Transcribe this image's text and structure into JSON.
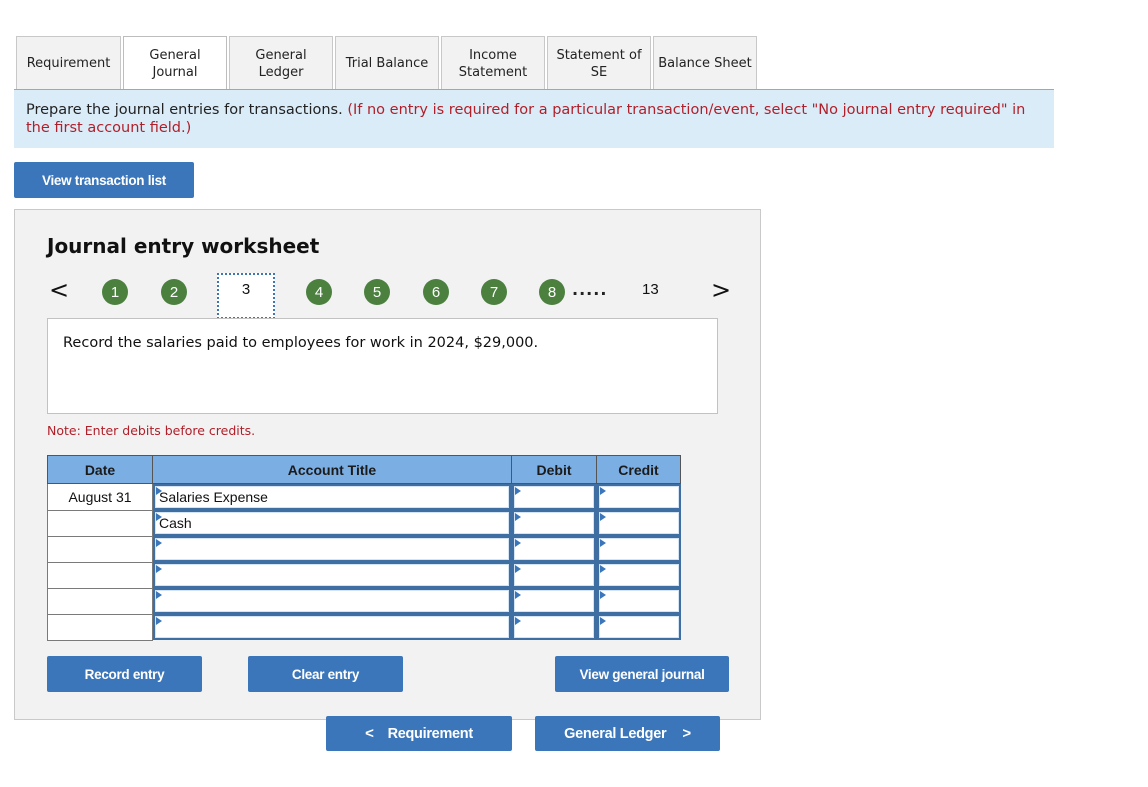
{
  "tabs": [
    {
      "label": "Requirement",
      "active": false
    },
    {
      "label": "General\nJournal",
      "active": true
    },
    {
      "label": "General\nLedger",
      "active": false
    },
    {
      "label": "Trial Balance",
      "active": false
    },
    {
      "label": "Income\nStatement",
      "active": false
    },
    {
      "label": "Statement of\nSE",
      "active": false
    },
    {
      "label": "Balance Sheet",
      "active": false
    }
  ],
  "instruction": {
    "main": "Prepare the journal entries for transactions.",
    "note": "(If no entry is required for a particular transaction/event, select \"No journal entry required\" in the first account field.)"
  },
  "view_transaction_list_label": "View transaction list",
  "worksheet": {
    "title": "Journal entry worksheet",
    "pager": {
      "prev_icon": "<",
      "next_icon": ">",
      "pages": [
        "1",
        "2",
        "3",
        "4",
        "5",
        "6",
        "7",
        "8"
      ],
      "current": "3",
      "ellipsis": ".....",
      "last": "13",
      "completed_color": "#4b803f"
    },
    "description": "Record the salaries paid to employees for work in 2024, $29,000.",
    "note": "Note: Enter debits before credits.",
    "table": {
      "headers": {
        "date": "Date",
        "account": "Account Title",
        "debit": "Debit",
        "credit": "Credit"
      },
      "rows": [
        {
          "date": "August 31",
          "account": "Salaries Expense",
          "debit": "",
          "credit": ""
        },
        {
          "date": "",
          "account": "Cash",
          "debit": "",
          "credit": ""
        },
        {
          "date": "",
          "account": "",
          "debit": "",
          "credit": ""
        },
        {
          "date": "",
          "account": "",
          "debit": "",
          "credit": ""
        },
        {
          "date": "",
          "account": "",
          "debit": "",
          "credit": ""
        },
        {
          "date": "",
          "account": "",
          "debit": "",
          "credit": ""
        }
      ]
    },
    "buttons": {
      "record": "Record entry",
      "clear": "Clear entry",
      "view_general_journal": "View general journal"
    }
  },
  "navigation": {
    "prev_label": "Requirement",
    "next_label": "General Ledger"
  },
  "colors": {
    "accent": "#3a76b9",
    "instruction_bg": "#dbecf9",
    "note_red": "#b0202a",
    "table_header": "#7baee3"
  }
}
